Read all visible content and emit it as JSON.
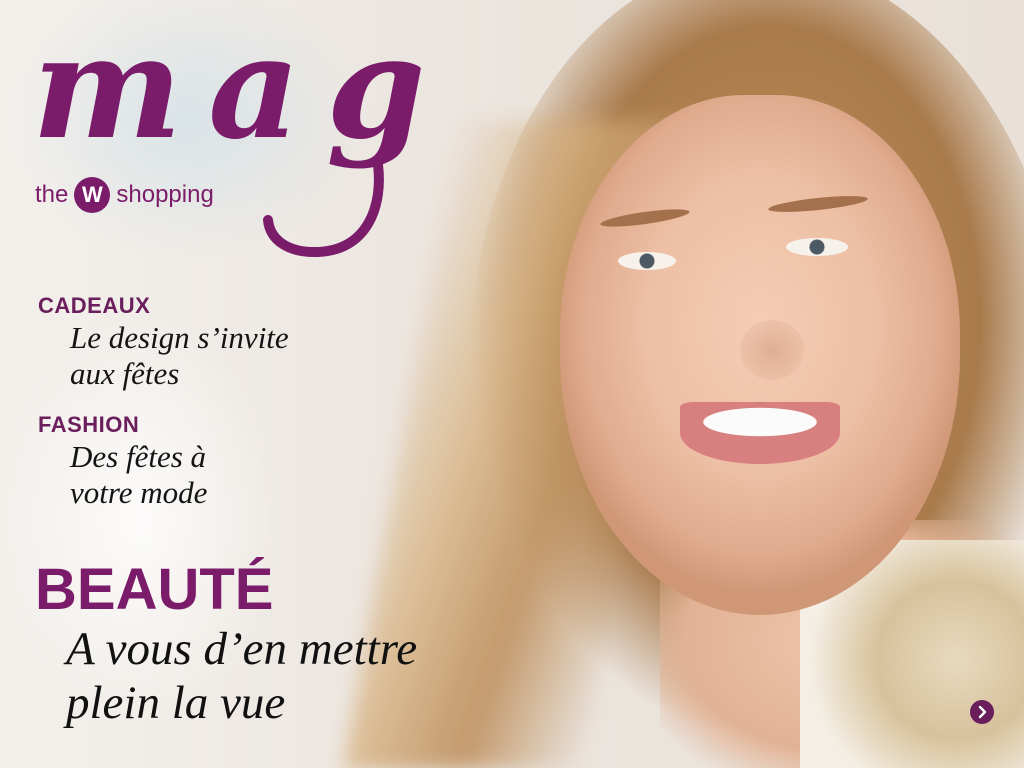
{
  "brand": {
    "logo_word": "mag",
    "logo_prefix": "the",
    "logo_badge": "W",
    "logo_suffix": "shopping",
    "accent_color": "#7b1c6a"
  },
  "sections": [
    {
      "kicker": "CADEAUX",
      "headline_line1": "Le design s’invite",
      "headline_line2": "aux fêtes"
    },
    {
      "kicker": "FASHION",
      "headline_line1": "Des fêtes à",
      "headline_line2": "votre mode"
    }
  ],
  "feature": {
    "kicker": "BEAUTÉ",
    "headline_line1": "A vous d’en mettre",
    "headline_line2": "plein la vue"
  },
  "navigation": {
    "next_icon": "chevron-right-icon"
  }
}
